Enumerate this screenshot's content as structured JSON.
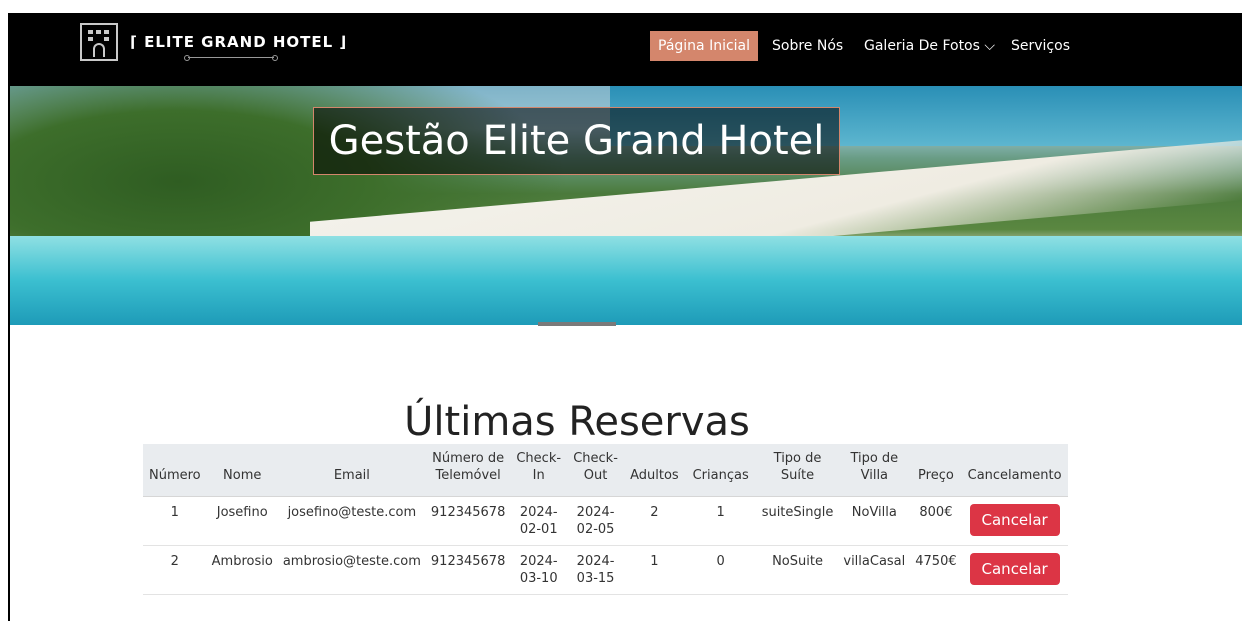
{
  "header": {
    "logo_text": "⌈ ELITE GRAND HOTEL ⌋",
    "nav": [
      {
        "label": "Página Inicial",
        "active": true
      },
      {
        "label": "Sobre Nós"
      },
      {
        "label": "Galeria De Fotos ⌵"
      },
      {
        "label": "Serviços"
      }
    ]
  },
  "hero": {
    "title": "Gestão Elite Grand Hotel"
  },
  "reservations": {
    "title": "Últimas Reservas",
    "columns": [
      "Número",
      "Nome",
      "Email",
      "Número de Telemóvel",
      "Check-In",
      "Check-Out",
      "Adultos",
      "Crianças",
      "Tipo de Suíte",
      "Tipo de Villa",
      "Preço",
      "Cancelamento"
    ],
    "rows": [
      {
        "numero": "1",
        "nome": "Josefino",
        "email": "josefino@teste.com",
        "telemovel": "912345678",
        "checkin": "2024-02-01",
        "checkout": "2024-02-05",
        "adultos": "2",
        "criancas": "1",
        "suite": "suiteSingle",
        "villa": "NoVilla",
        "preco": "800€",
        "cancel_label": "Cancelar"
      },
      {
        "numero": "2",
        "nome": "Ambrosio",
        "email": "ambrosio@teste.com",
        "telemovel": "912345678",
        "checkin": "2024-03-10",
        "checkout": "2024-03-15",
        "adultos": "1",
        "criancas": "0",
        "suite": "NoSuite",
        "villa": "villaCasal",
        "preco": "4750€",
        "cancel_label": "Cancelar"
      }
    ]
  },
  "colors": {
    "accent": "#d4866c",
    "cancel": "#dc3545",
    "nav_bg": "#000000"
  }
}
